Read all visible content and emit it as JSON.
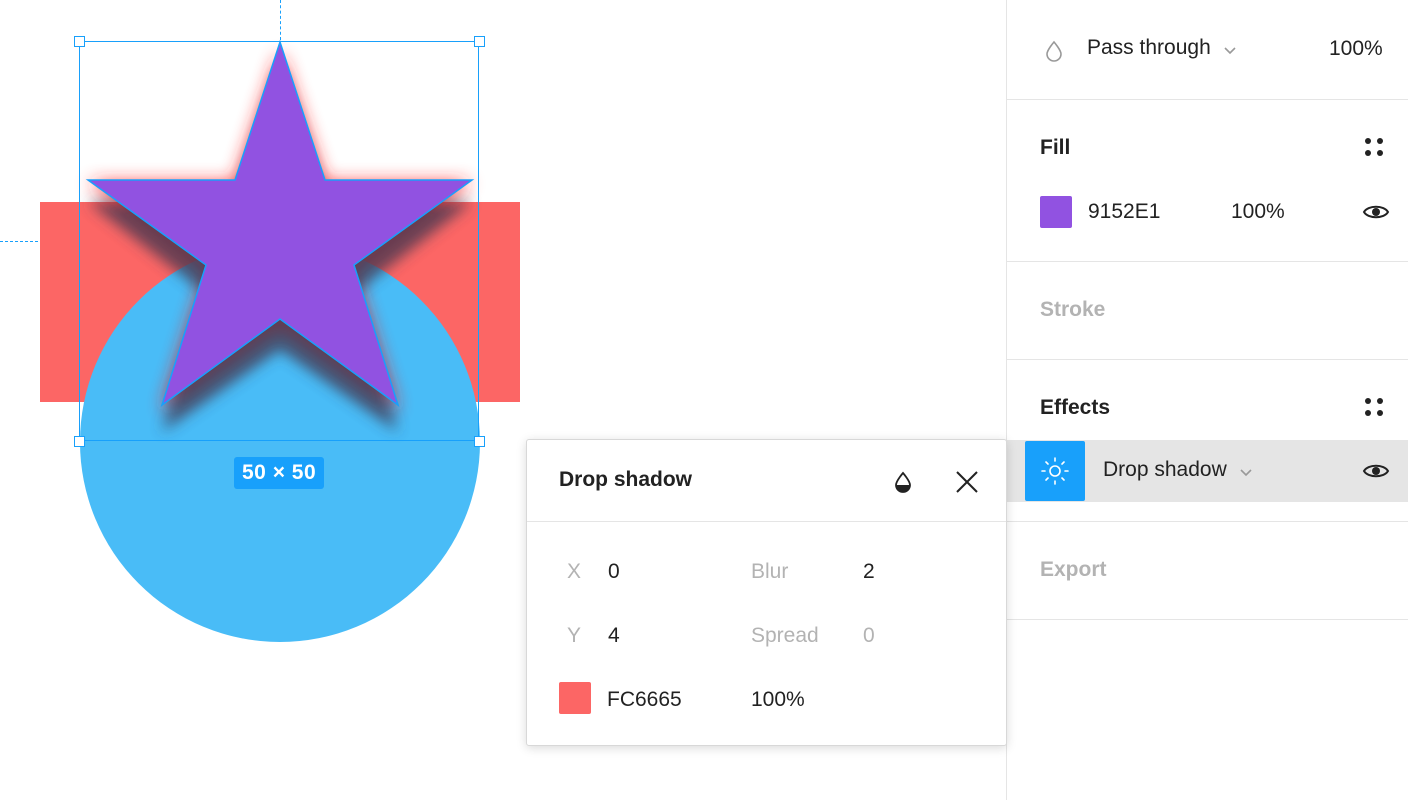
{
  "canvas": {
    "size_label": "50 × 50",
    "colors": {
      "rectangle": "#FC6665",
      "circle": "#49BCF7",
      "star": "#9152E1",
      "selection": "#18A0FB"
    }
  },
  "layer": {
    "icon": "drop-icon",
    "blend_mode": "Pass through",
    "opacity": "100%"
  },
  "fill": {
    "title": "Fill",
    "color_hex": "9152E1",
    "swatch_color": "#9152E1",
    "opacity": "100%"
  },
  "stroke": {
    "title": "Stroke"
  },
  "effects": {
    "title": "Effects",
    "items": [
      {
        "label": "Drop shadow",
        "icon": "sun-icon"
      }
    ]
  },
  "export": {
    "title": "Export"
  },
  "popup": {
    "title": "Drop shadow",
    "x_label": "X",
    "x_value": "0",
    "y_label": "Y",
    "y_value": "4",
    "blur_label": "Blur",
    "blur_value": "2",
    "spread_label": "Spread",
    "spread_value": "0",
    "color_hex": "FC6665",
    "swatch_color": "#FC6665",
    "opacity": "100%"
  }
}
